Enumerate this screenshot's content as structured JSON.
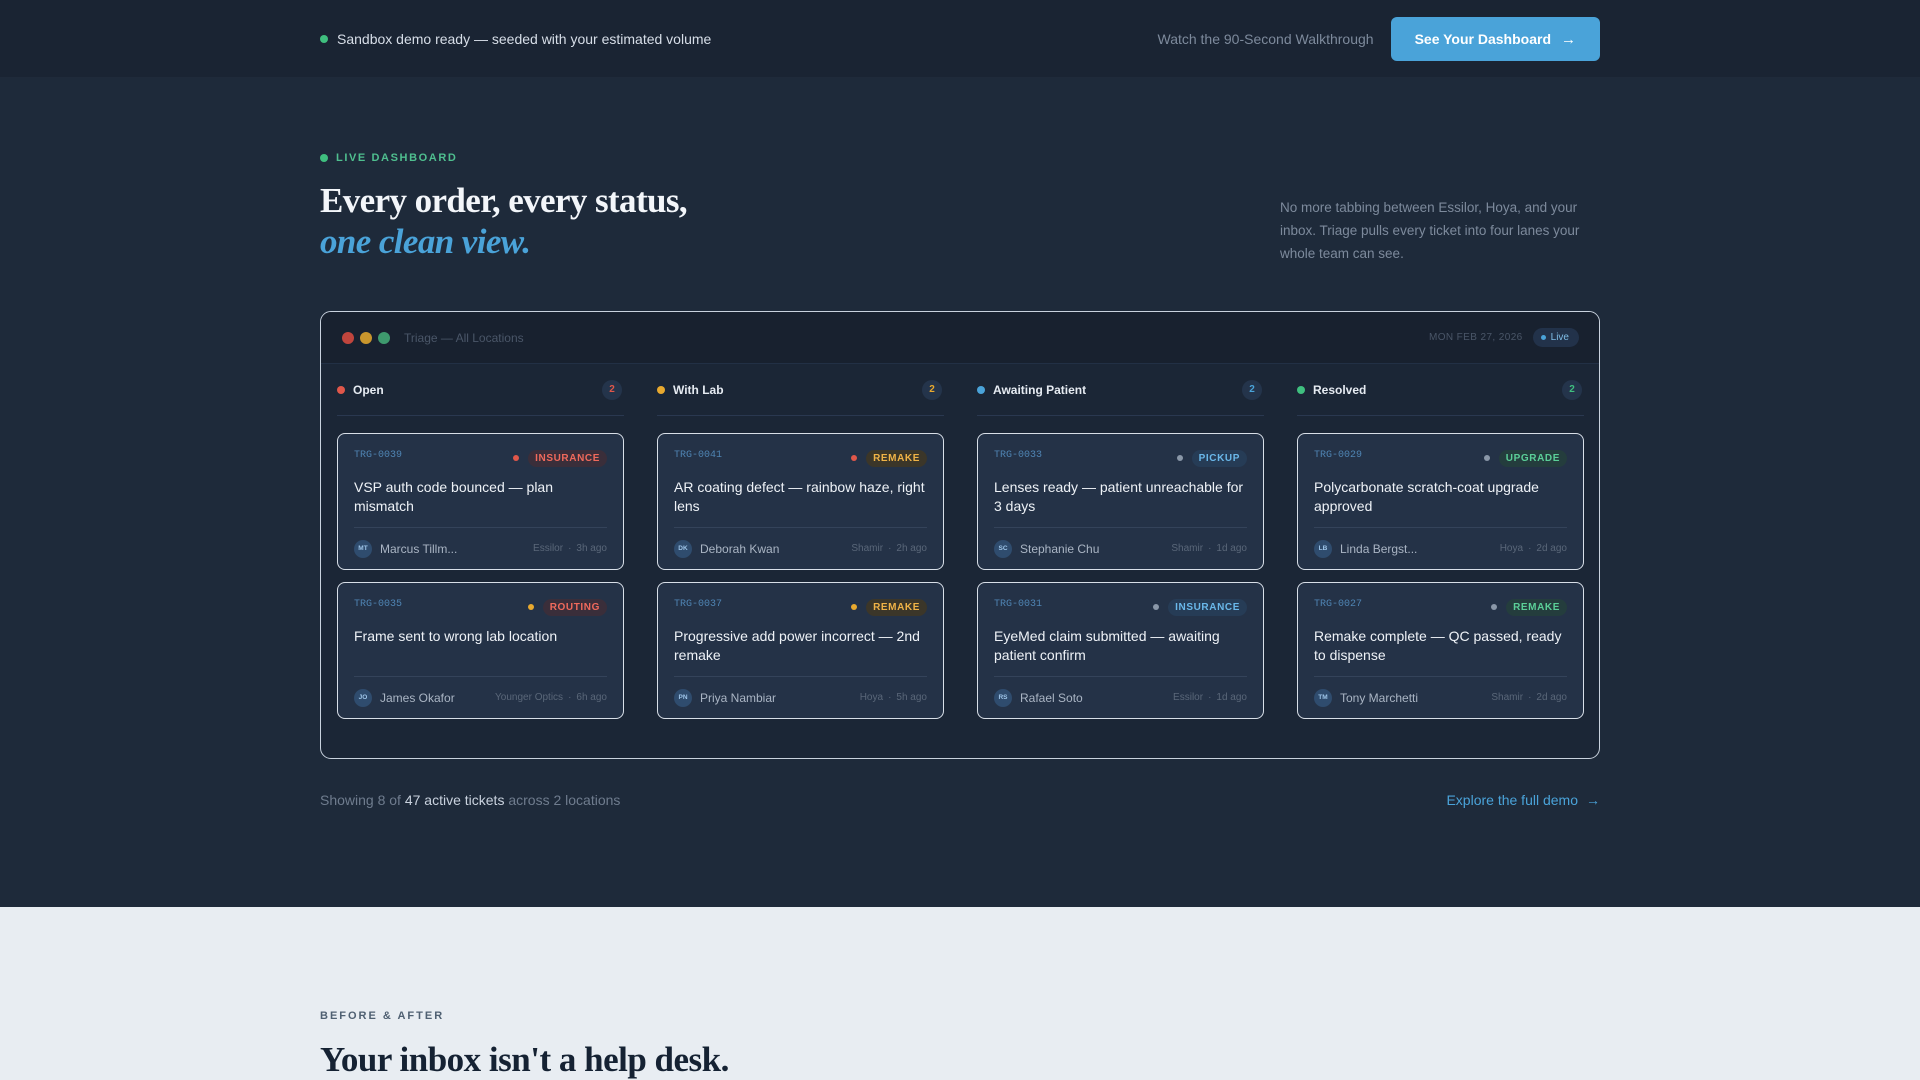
{
  "topbar": {
    "status_text": "Sandbox demo ready — seeded with your estimated volume",
    "walkthrough_link": "Watch the 90-Second Walkthrough",
    "cta_label": "See Your Dashboard",
    "cta_arrow": "→"
  },
  "hero": {
    "eyebrow": "LIVE DASHBOARD",
    "headline_line1": "Every order, every status,",
    "headline_line2": "one clean view.",
    "intro": "No more tabbing between Essilor, Hoya, and your inbox. Triage pulls every ticket into four lanes your whole team can see."
  },
  "panel": {
    "title": "Triage — All Locations",
    "date": "MON FEB 27, 2026",
    "live_label": "Live"
  },
  "columns": [
    {
      "name": "Open",
      "count": "2",
      "color": "#e0574a",
      "cards": [
        {
          "id": "TRG-0039",
          "badge": "INSURANCE",
          "badge_color": "#f06a5c",
          "badge_bg": "#3a2e3a",
          "badge_dot": "#e0574a",
          "title": "VSP auth code bounced — plan mismatch",
          "initials": "MT",
          "person": "Marcus Tillm...",
          "lab": "Essilor",
          "age": "3h ago"
        },
        {
          "id": "TRG-0035",
          "badge": "ROUTING",
          "badge_color": "#f06a5c",
          "badge_bg": "#3a2e3a",
          "badge_dot": "#e8a92f",
          "title": "Frame sent to wrong lab location",
          "initials": "JO",
          "person": "James Okafor",
          "lab": "Younger Optics",
          "age": "6h ago"
        }
      ]
    },
    {
      "name": "With Lab",
      "count": "2",
      "color": "#e8a92f",
      "cards": [
        {
          "id": "TRG-0041",
          "badge": "REMAKE",
          "badge_color": "#f0b347",
          "badge_bg": "#3b3629",
          "badge_dot": "#e0574a",
          "title": "AR coating defect — rainbow haze, right lens",
          "initials": "DK",
          "person": "Deborah Kwan",
          "lab": "Shamir",
          "age": "2h ago"
        },
        {
          "id": "TRG-0037",
          "badge": "REMAKE",
          "badge_color": "#f0b347",
          "badge_bg": "#3b3629",
          "badge_dot": "#e8a92f",
          "title": "Progressive add power incorrect — 2nd remake",
          "initials": "PN",
          "person": "Priya Nambiar",
          "lab": "Hoya",
          "age": "5h ago"
        }
      ]
    },
    {
      "name": "Awaiting Patient",
      "count": "2",
      "color": "#4aa3d9",
      "cards": [
        {
          "id": "TRG-0033",
          "badge": "PICKUP",
          "badge_color": "#6ab8ea",
          "badge_bg": "#263c56",
          "badge_dot": "#8a97a8",
          "title": "Lenses ready — patient unreachable for 3 days",
          "initials": "SC",
          "person": "Stephanie Chu",
          "lab": "Shamir",
          "age": "1d ago"
        },
        {
          "id": "TRG-0031",
          "badge": "INSURANCE",
          "badge_color": "#6ab8ea",
          "badge_bg": "#263c56",
          "badge_dot": "#8a97a8",
          "title": "EyeMed claim submitted — awaiting patient confirm",
          "initials": "RS",
          "person": "Rafael Soto",
          "lab": "Essilor",
          "age": "1d ago"
        }
      ]
    },
    {
      "name": "Resolved",
      "count": "2",
      "color": "#3fbf7f",
      "cards": [
        {
          "id": "TRG-0029",
          "badge": "UPGRADE",
          "badge_color": "#5bcf98",
          "badge_bg": "#243d3d",
          "badge_dot": "#8a97a8",
          "title": "Polycarbonate scratch-coat upgrade approved",
          "initials": "LB",
          "person": "Linda Bergst...",
          "lab": "Hoya",
          "age": "2d ago"
        },
        {
          "id": "TRG-0027",
          "badge": "REMAKE",
          "badge_color": "#5bcf98",
          "badge_bg": "#243d3d",
          "badge_dot": "#8a97a8",
          "title": "Remake complete — QC passed, ready to dispense",
          "initials": "TM",
          "person": "Tony Marchetti",
          "lab": "Shamir",
          "age": "2d ago"
        }
      ]
    }
  ],
  "footer": {
    "showing_prefix": "Showing 8 of",
    "showing_bold": "47 active tickets",
    "showing_suffix": "across 2 locations",
    "explore_label": "Explore the full demo",
    "explore_arrow": "→"
  },
  "before_after": {
    "eyebrow": "BEFORE & AFTER",
    "headline": "Your inbox isn't a help desk."
  }
}
